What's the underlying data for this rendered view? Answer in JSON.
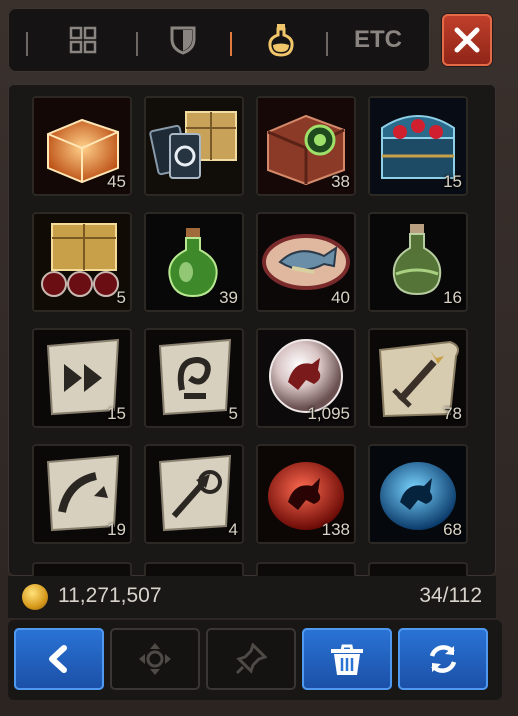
{
  "tabs": [
    {
      "id": "all",
      "icon": "grid-icon"
    },
    {
      "id": "equipment",
      "icon": "shield-icon"
    },
    {
      "id": "consumable",
      "icon": "potion-icon",
      "active": true
    },
    {
      "id": "etc",
      "label": "ETC"
    }
  ],
  "close_icon": "close-icon",
  "items": [
    {
      "icon": "orange-chest-icon",
      "qty": "45"
    },
    {
      "icon": "chest-with-cards-icon",
      "qty": ""
    },
    {
      "icon": "green-seal-chest-icon",
      "qty": "38"
    },
    {
      "icon": "gem-chest-icon",
      "qty": "15"
    },
    {
      "icon": "gold-chest-with-orbs-icon",
      "qty": "5"
    },
    {
      "icon": "green-potion-icon",
      "qty": "39"
    },
    {
      "icon": "fish-plate-icon",
      "qty": "40"
    },
    {
      "icon": "green-flask-icon",
      "qty": "16"
    },
    {
      "icon": "dash-scroll-icon",
      "qty": "15"
    },
    {
      "icon": "spiral-scroll-icon",
      "qty": "5"
    },
    {
      "icon": "dragon-orb-icon",
      "qty": "1,095"
    },
    {
      "icon": "sword-scroll-icon",
      "qty": "78"
    },
    {
      "icon": "slash-scroll-icon",
      "qty": "19"
    },
    {
      "icon": "arrow-scroll-icon",
      "qty": "4"
    },
    {
      "icon": "red-dragon-stone-icon",
      "qty": "138"
    },
    {
      "icon": "blue-dragon-stone-icon",
      "qty": "68"
    }
  ],
  "gold": "11,271,507",
  "capacity": "34/112",
  "buttons": [
    {
      "icon": "back-arrow-icon",
      "style": "blue"
    },
    {
      "icon": "move-icon",
      "style": "gray"
    },
    {
      "icon": "pin-icon",
      "style": "gray"
    },
    {
      "icon": "trash-icon",
      "style": "blue"
    },
    {
      "icon": "refresh-icon",
      "style": "blue"
    }
  ]
}
